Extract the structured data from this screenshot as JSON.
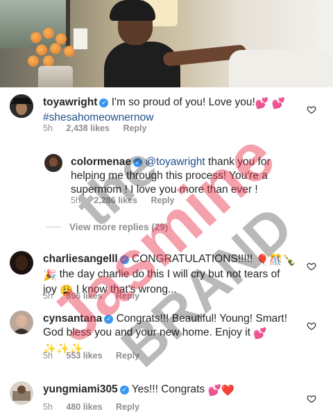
{
  "comments": [
    {
      "username": "toyawright",
      "text_line1": "I'm so proud of you!  Love you!",
      "hashtag": "#shesahomeownernow",
      "time": "5h",
      "likes": "2,438 likes",
      "reply": "Reply"
    },
    {
      "username": "colormenae",
      "mention": "@toyawright",
      "text_line1": " thank you for",
      "text_line2": "helping me through this process! You're a",
      "text_line3": "supermom ! I love you more than ever !",
      "time": "5h",
      "likes": "2,286 likes",
      "reply": "Reply"
    },
    {
      "username": "charliesangelll",
      "text_line1": "CONGRATULATIONS!!!!!",
      "text_line2": " the day charlie do this I will cry but not tears of",
      "text_line3": "joy",
      "text_line3b": " I know that's wrong...",
      "time": "5h",
      "likes": "896 likes",
      "reply": "Reply"
    },
    {
      "username": "cynsantana",
      "text_line1": "Congrats!!! Beautiful! Young! Smart!",
      "text_line2": "God bless you and your new home. Enjoy it",
      "text_line3": "✨✨✨",
      "time": "5h",
      "likes": "553 likes",
      "reply": "Reply"
    },
    {
      "username": "yungmiami305",
      "text_line1": "Yes!!! Congrats",
      "time": "5h",
      "likes": "480 likes",
      "reply": "Reply"
    }
  ],
  "view_more": "View more replies (29)",
  "watermark": {
    "line1": "the",
    "line2": "Jasmine",
    "line3": "BRAND"
  },
  "colors": {
    "text": "#262626",
    "meta": "#8e8e8e",
    "hashtag": "#1e4f8a",
    "verified": "#3897f0",
    "watermark_red": "#e8314a",
    "watermark_black": "#1a1a1a"
  }
}
